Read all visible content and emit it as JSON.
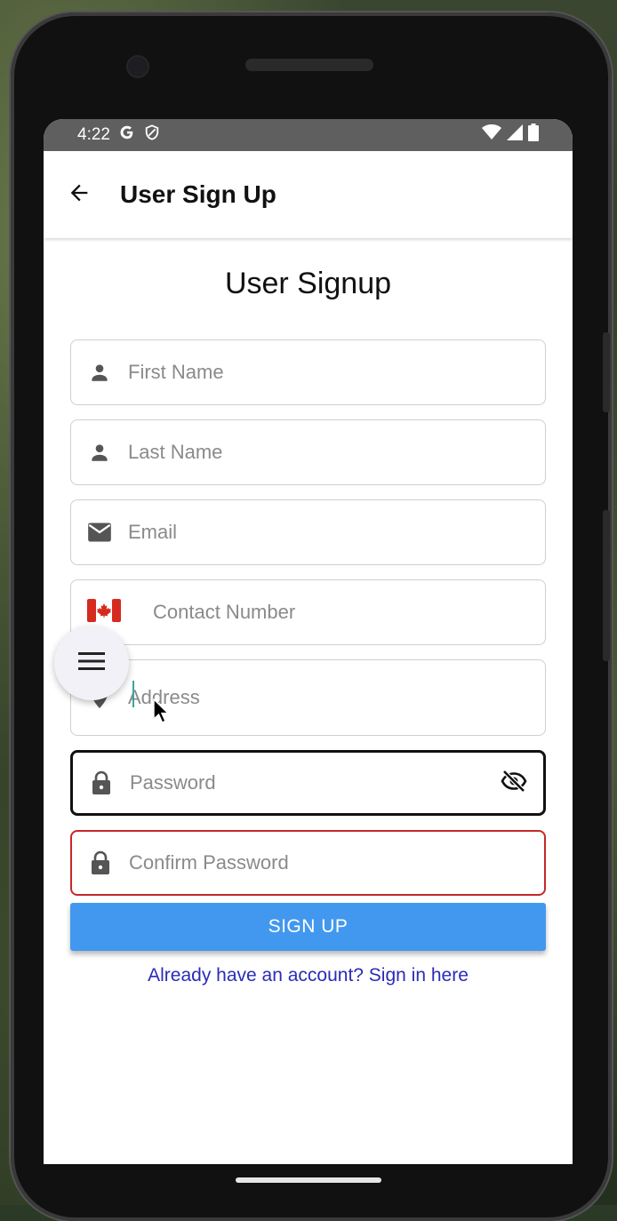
{
  "status_bar": {
    "time": "4:22",
    "left_icons": [
      "google-g-icon",
      "shield-icon"
    ],
    "right_icons": [
      "wifi-icon",
      "signal-icon",
      "battery-icon"
    ]
  },
  "app_bar": {
    "title": "User Sign Up",
    "back_icon": "arrow-left-icon"
  },
  "form": {
    "heading": "User Signup",
    "fields": {
      "first_name": {
        "placeholder": "First Name",
        "icon": "person-icon"
      },
      "last_name": {
        "placeholder": "Last Name",
        "icon": "person-icon"
      },
      "email": {
        "placeholder": "Email",
        "icon": "mail-icon"
      },
      "contact": {
        "placeholder": "Contact Number",
        "icon": "canada-flag-icon"
      },
      "address": {
        "placeholder": "Address",
        "icon": "location-pin-icon"
      },
      "password": {
        "placeholder": "Password",
        "icon": "lock-icon",
        "trailing_icon": "eye-off-icon"
      },
      "confirm_password": {
        "placeholder": "Confirm Password",
        "icon": "lock-icon"
      }
    },
    "submit_label": "SIGN UP",
    "signin_link": "Already have an account? Sign in here"
  },
  "fab": {
    "icon": "menu-icon"
  },
  "colors": {
    "primary_button": "#4298ee",
    "link": "#2b2bb8",
    "error_border": "#c62828",
    "focused_border": "#111111",
    "status_bar": "#5f5f5f"
  }
}
